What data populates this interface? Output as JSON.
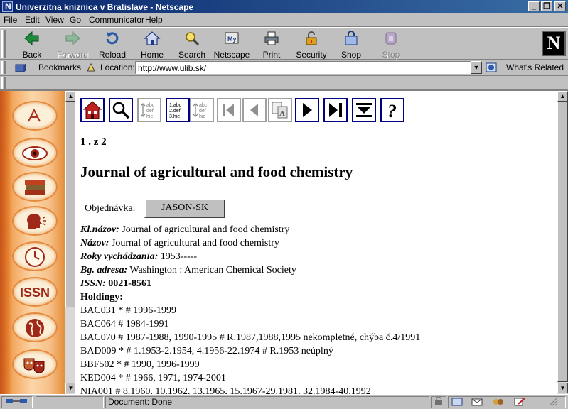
{
  "window": {
    "title": "Univerzitna kniznica v Bratislave - Netscape",
    "minimize": "_",
    "maximize": "❐",
    "close": "✕"
  },
  "menu": [
    "File",
    "Edit",
    "View",
    "Go",
    "Communicator",
    "Help"
  ],
  "nav_buttons": [
    {
      "label": "Back",
      "icon": "back-arrow-icon",
      "enabled": true
    },
    {
      "label": "Forward",
      "icon": "forward-arrow-icon",
      "enabled": false
    },
    {
      "label": "Reload",
      "icon": "reload-icon",
      "enabled": true
    },
    {
      "label": "Home",
      "icon": "home-icon",
      "enabled": true
    },
    {
      "label": "Search",
      "icon": "search-icon",
      "enabled": true
    },
    {
      "label": "Netscape",
      "icon": "netscape-icon",
      "enabled": true
    },
    {
      "label": "Print",
      "icon": "print-icon",
      "enabled": true
    },
    {
      "label": "Security",
      "icon": "security-lock-icon",
      "enabled": true
    },
    {
      "label": "Shop",
      "icon": "shop-bag-icon",
      "enabled": true
    },
    {
      "label": "Stop",
      "icon": "stop-icon",
      "enabled": false
    }
  ],
  "netscape_logo": "N",
  "location_bar": {
    "bookmarks_label": "Bookmarks",
    "location_label": "Location:",
    "url": "http://www.ulib.sk/",
    "whats_related": "What's Related"
  },
  "sidebar_icons": [
    "translation-icon",
    "eye-icon",
    "books-icon",
    "speaking-head-icon",
    "clock-icon",
    "issn-icon",
    "globe-icon",
    "theater-masks-icon"
  ],
  "sidebar_issn_text": "ISSN",
  "catalog_toolbar": {
    "icons": [
      "home-catalog-icon",
      "magnifier-icon",
      "short-list-icon",
      "numbered-list-icon",
      "full-record-icon",
      "first-record-icon",
      "previous-record-icon",
      "compare-icon",
      "next-record-icon",
      "last-record-icon",
      "download-icon",
      "help-icon"
    ],
    "list_glyph_lines": [
      "abc",
      "def",
      "hie"
    ],
    "numbered_glyph_lines": [
      "1.abc",
      "2.def",
      "3.hie"
    ],
    "help_glyph": "?"
  },
  "record": {
    "position": "1 . z 2",
    "title": "Journal of agricultural and food chemistry",
    "order_label": "Objednávka:",
    "order_button": "JASON-SK",
    "fields": [
      {
        "label": "Kl.názov:",
        "value": "Journal of agricultural and food chemistry"
      },
      {
        "label": "Názov:",
        "value": "Journal of agricultural and food chemistry"
      },
      {
        "label": "Roky vychádzania:",
        "value": "1953-----"
      },
      {
        "label": "Bg. adresa:",
        "value": "Washington : American Chemical Society"
      },
      {
        "label": "ISSN:",
        "value": "0021-8561"
      }
    ],
    "holdings_label": "Holdingy:",
    "holdings": [
      "BAC031 * # 1996-1999",
      "BAC064 # 1984-1991",
      "BAC070 # 1987-1988, 1990-1995 # R.1987,1988,1995 nekompletné, chýba č.4/1991",
      "BAD009 * # 1.1953-2.1954, 4.1956-22.1974 # R.1953 neúplný",
      "BBF502 * # 1990, 1996-1999",
      "KED004 * # 1966, 1971, 1974-2001",
      "NIA001 # 8.1960, 10.1962, 13.1965, 15.1967-29.1981, 32.1984-40.1992"
    ]
  },
  "status": {
    "text": "Document: Done"
  }
}
